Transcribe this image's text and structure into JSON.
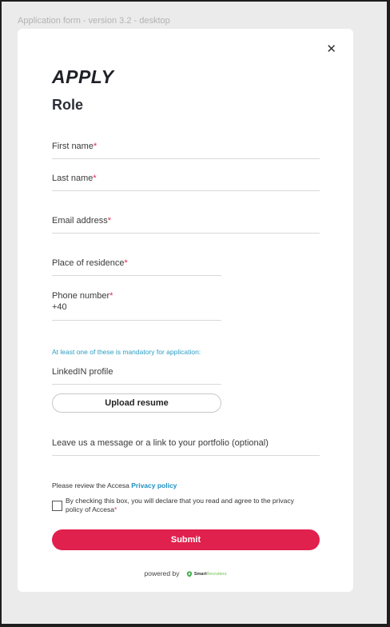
{
  "frame_label": "Application form - version 3.2 - desktop",
  "header": {
    "brand": "APPLY",
    "role_title": "Role",
    "close_glyph": "✕"
  },
  "fields": {
    "first_name": {
      "label": "First name",
      "required": "*"
    },
    "last_name": {
      "label": "Last name",
      "required": "*"
    },
    "email": {
      "label": "Email address",
      "required": "*"
    },
    "residence": {
      "label": "Place of residence",
      "required": "*"
    },
    "phone": {
      "label": "Phone number",
      "required": "*",
      "value": "+40"
    },
    "linkedin": {
      "label": "LinkedIN profile"
    },
    "message": {
      "label": "Leave us a message or a link to your portfolio (optional)"
    }
  },
  "mandatory_note": "At least one of these is mandatory for application:",
  "upload_label": "Upload resume",
  "privacy": {
    "prefix": "Please review the Accesa ",
    "link": "Privacy policy"
  },
  "consent": {
    "text": "By checking this box, you will declare that you read and agree to the privacy policy of Accesa",
    "required": "*",
    "checked": false
  },
  "submit_label": "Submit",
  "footer": {
    "powered_by": "powered by",
    "logo_smart": "Smart",
    "logo_recruiters": "Recruiters"
  },
  "colors": {
    "accent": "#e0204d",
    "link": "#1d8fc0",
    "note": "#2a9ec3"
  }
}
